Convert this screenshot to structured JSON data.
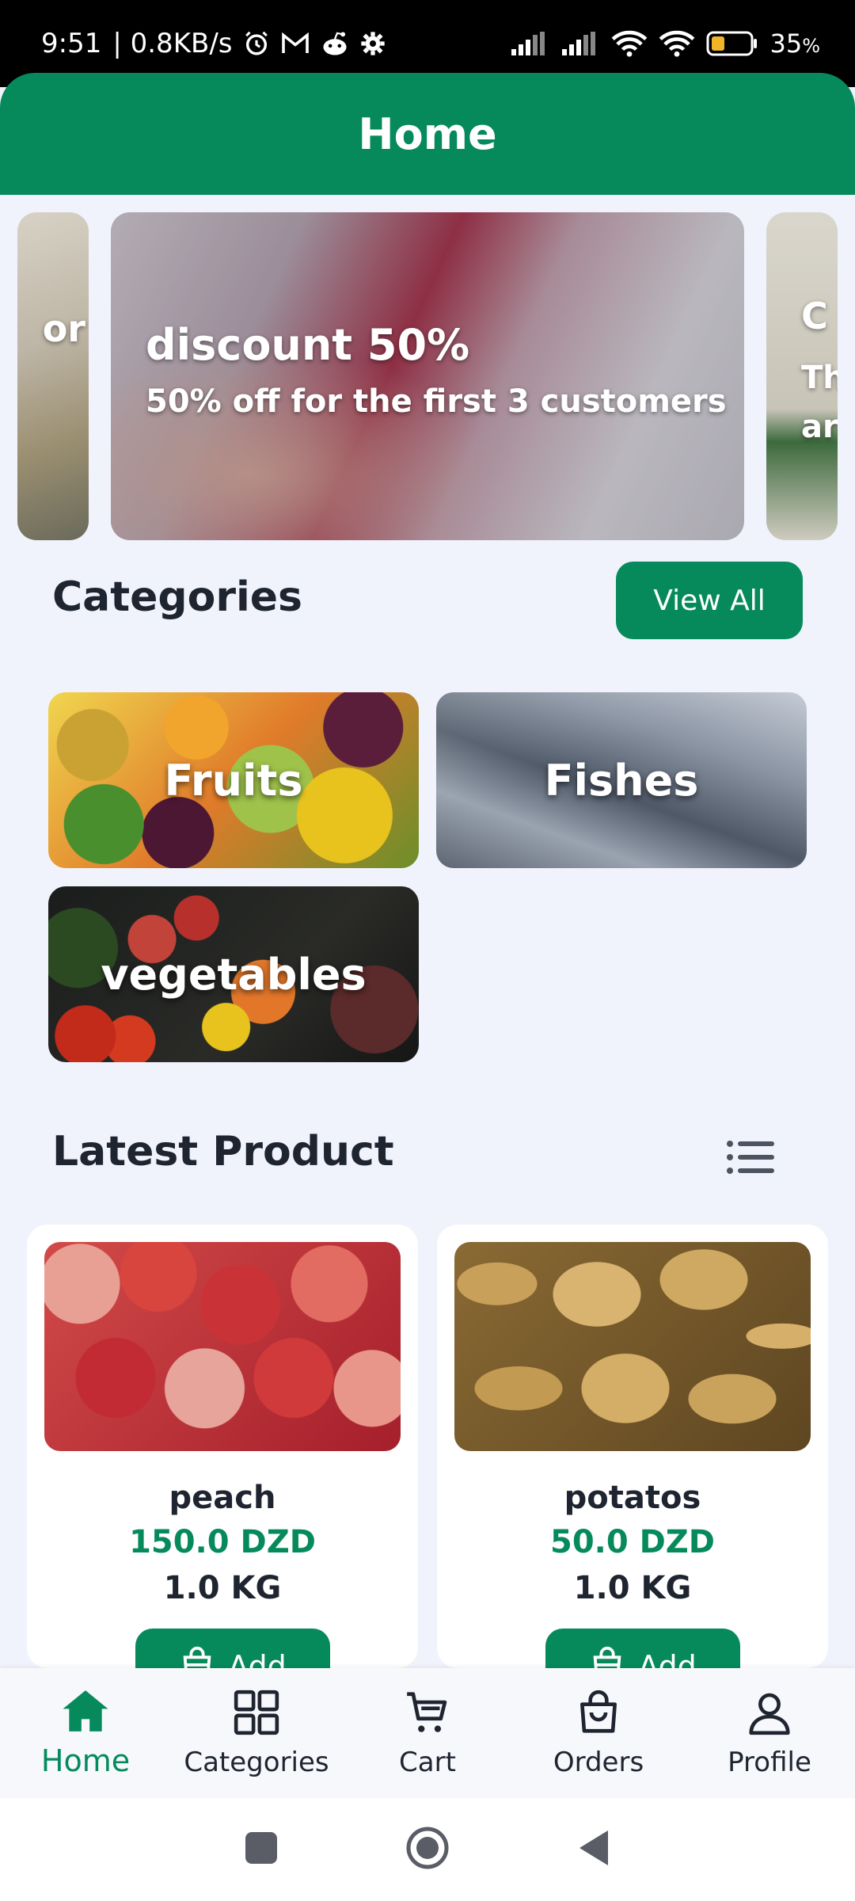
{
  "status_bar": {
    "time": "9:51",
    "net_speed": "| 0.8KB/s",
    "battery": "35",
    "battery_unit": "%",
    "battery_level": 0.35,
    "icons": [
      "alarm-icon",
      "gmail-icon",
      "reddit-icon",
      "gear-icon",
      "signal-icon",
      "signal-icon",
      "wifi-icon",
      "wifi-icon",
      "battery-icon"
    ]
  },
  "header": {
    "title": "Home"
  },
  "carousel": {
    "left_fragment": "or",
    "center": {
      "title": "discount 50%",
      "subtitle": "50% off for the first 3 customers"
    },
    "right_fragments": [
      "C",
      "Th",
      "ar"
    ]
  },
  "categories": {
    "title": "Categories",
    "view_all": "View All",
    "items": [
      {
        "label": "Fruits"
      },
      {
        "label": "Fishes"
      },
      {
        "label": "vegetables"
      }
    ]
  },
  "latest": {
    "title": "Latest Product",
    "products": [
      {
        "name": "peach",
        "price": "150.0 DZD",
        "unit": "1.0 KG",
        "add": "Add"
      },
      {
        "name": "potatos",
        "price": "50.0 DZD",
        "unit": "1.0 KG",
        "add": "Add"
      }
    ]
  },
  "bottom_nav": {
    "items": [
      {
        "label": "Home",
        "active": true
      },
      {
        "label": "Categories"
      },
      {
        "label": "Cart"
      },
      {
        "label": "Orders"
      },
      {
        "label": "Profile"
      }
    ]
  },
  "colors": {
    "accent": "#068a5c",
    "background": "#f1f3fc",
    "text": "#1f2530"
  }
}
